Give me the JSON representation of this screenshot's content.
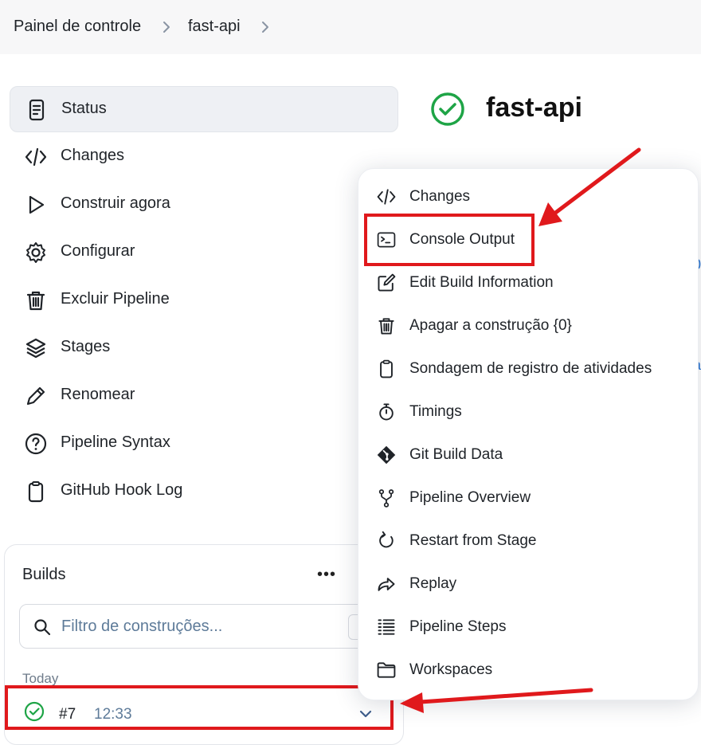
{
  "breadcrumb": {
    "items": [
      "Painel de controle",
      "fast-api"
    ]
  },
  "sidebar": {
    "items": [
      {
        "label": "Status",
        "icon": "document-icon",
        "active": true
      },
      {
        "label": "Changes",
        "icon": "code-icon"
      },
      {
        "label": "Construir agora",
        "icon": "play-icon"
      },
      {
        "label": "Configurar",
        "icon": "gear-icon"
      },
      {
        "label": "Excluir Pipeline",
        "icon": "trash-icon"
      },
      {
        "label": "Stages",
        "icon": "layers-icon"
      },
      {
        "label": "Renomear",
        "icon": "pencil-icon"
      },
      {
        "label": "Pipeline Syntax",
        "icon": "help-circle-icon"
      },
      {
        "label": "GitHub Hook Log",
        "icon": "clipboard-icon"
      }
    ]
  },
  "page": {
    "title": "fast-api",
    "status_icon": "success-check-icon"
  },
  "builds": {
    "title": "Builds",
    "more_label": "•••",
    "filter_placeholder": "Filtro de construções...",
    "group_label": "Today",
    "rows": [
      {
        "number": "#7",
        "time": "12:33",
        "status": "success"
      }
    ]
  },
  "context_menu": {
    "items": [
      {
        "label": "Changes",
        "icon": "code-icon"
      },
      {
        "label": "Console Output",
        "icon": "terminal-icon",
        "highlighted": true
      },
      {
        "label": "Edit Build Information",
        "icon": "edit-icon"
      },
      {
        "label": "Apagar a construção {0}",
        "icon": "trash-icon"
      },
      {
        "label": "Sondagem de registro de atividades",
        "icon": "clipboard-icon"
      },
      {
        "label": "Timings",
        "icon": "stopwatch-icon"
      },
      {
        "label": "Git Build Data",
        "icon": "git-icon"
      },
      {
        "label": "Pipeline Overview",
        "icon": "branch-icon"
      },
      {
        "label": "Restart from Stage",
        "icon": "restart-icon"
      },
      {
        "label": "Replay",
        "icon": "replay-arrow-icon"
      },
      {
        "label": "Pipeline Steps",
        "icon": "list-steps-icon"
      },
      {
        "label": "Workspaces",
        "icon": "folder-icon"
      }
    ]
  },
  "colors": {
    "success": "#1ea446",
    "annotation_red": "#e0191c",
    "link": "#1f6fd1"
  }
}
